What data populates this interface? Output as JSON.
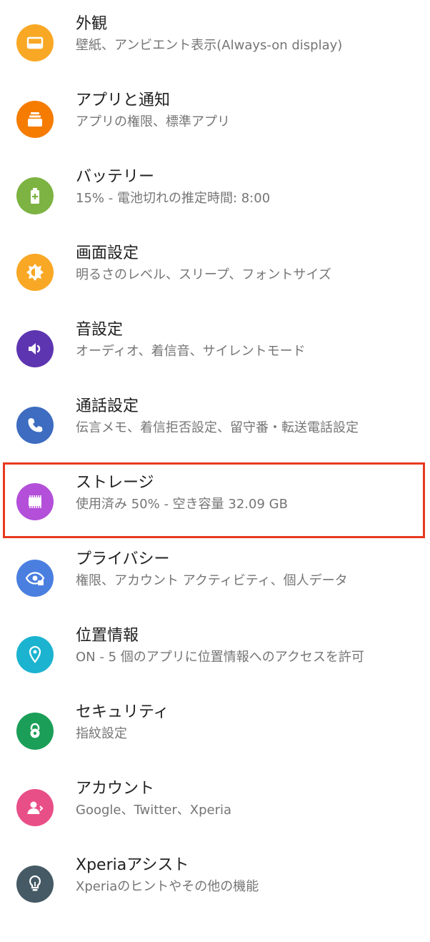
{
  "settings": {
    "items": [
      {
        "title": "外観",
        "subtitle": "壁紙、アンビエント表示(Always-on display)",
        "icon": "appearance-icon",
        "color": "#f9a825"
      },
      {
        "title": "アプリと通知",
        "subtitle": "アプリの権限、標準アプリ",
        "icon": "apps-icon",
        "color": "#f57c00"
      },
      {
        "title": "バッテリー",
        "subtitle": "15% - 電池切れの推定時間: 8:00",
        "icon": "battery-icon",
        "color": "#7cb342"
      },
      {
        "title": "画面設定",
        "subtitle": "明るさのレベル、スリープ、フォントサイズ",
        "icon": "brightness-icon",
        "color": "#f9a825"
      },
      {
        "title": "音設定",
        "subtitle": "オーディオ、着信音、サイレントモード",
        "icon": "volume-icon",
        "color": "#5e35b1"
      },
      {
        "title": "通話設定",
        "subtitle": "伝言メモ、着信拒否設定、留守番・転送電話設定",
        "icon": "phone-icon",
        "color": "#3d6cc0"
      },
      {
        "title": "ストレージ",
        "subtitle": "使用済み 50% - 空き容量 32.09 GB",
        "icon": "storage-icon",
        "color": "#b34fd9"
      },
      {
        "title": "プライバシー",
        "subtitle": "権限、アカウント アクティビティ、個人データ",
        "icon": "privacy-icon",
        "color": "#4a7fe0"
      },
      {
        "title": "位置情報",
        "subtitle": "ON - 5 個のアプリに位置情報へのアクセスを許可",
        "icon": "location-icon",
        "color": "#1bb3cf"
      },
      {
        "title": "セキュリティ",
        "subtitle": "指紋設定",
        "icon": "lock-icon",
        "color": "#1b9e57"
      },
      {
        "title": "アカウント",
        "subtitle": "Google、Twitter、Xperia",
        "icon": "account-icon",
        "color": "#e94f87"
      },
      {
        "title": "Xperiaアシスト",
        "subtitle": "Xperiaのヒントやその他の機能",
        "icon": "lightbulb-icon",
        "color": "#455a64"
      }
    ]
  },
  "highlight": {
    "color": "#e8391f"
  }
}
